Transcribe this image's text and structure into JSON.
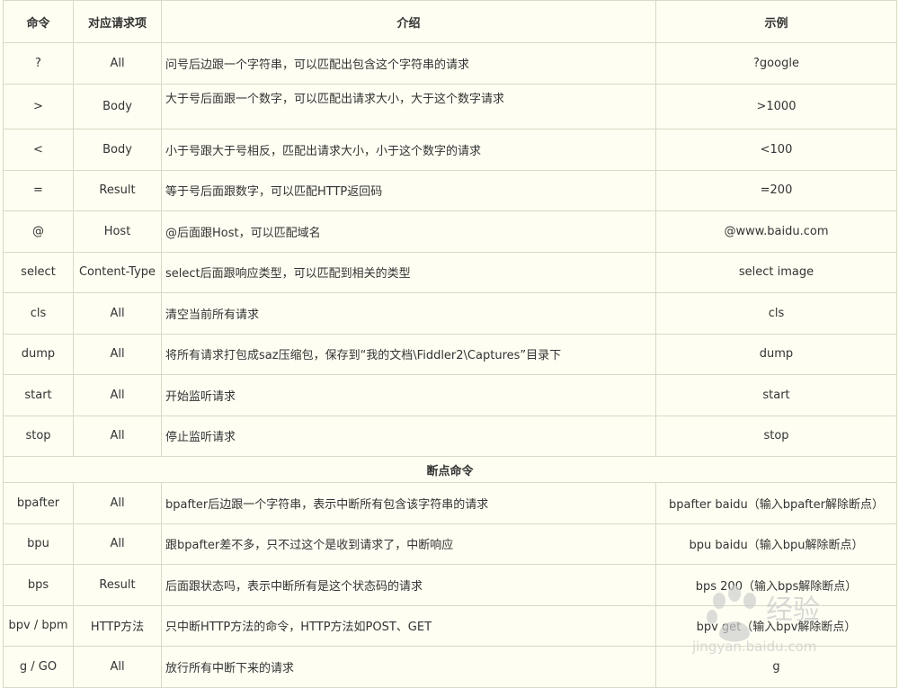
{
  "headers": {
    "command": "命令",
    "target": "对应请求项",
    "intro": "介绍",
    "example": "示例"
  },
  "rows": [
    {
      "command": "?",
      "target": "All",
      "intro": "问号后边跟一个字符串，可以匹配出包含这个字符串的请求",
      "example": "?google"
    },
    {
      "command": ">",
      "target": "Body",
      "intro": "大于号后面跟一个数字，可以匹配出请求大小，大于这个数字请求",
      "example": ">1000",
      "intro_top": true
    },
    {
      "command": "<",
      "target": "Body",
      "intro": "小于号跟大于号相反，匹配出请求大小，小于这个数字的请求",
      "example": "<100"
    },
    {
      "command": "=",
      "target": "Result",
      "intro": "等于号后面跟数字，可以匹配HTTP返回码",
      "example": "=200"
    },
    {
      "command": "@",
      "target": "Host",
      "intro": "@后面跟Host，可以匹配域名",
      "example": "@www.baidu.com"
    },
    {
      "command": "select",
      "target": "Content-Type",
      "intro": "select后面跟响应类型，可以匹配到相关的类型",
      "example": "select image"
    },
    {
      "command": "cls",
      "target": "All",
      "intro": "清空当前所有请求",
      "example": "cls"
    },
    {
      "command": "dump",
      "target": "All",
      "intro": "将所有请求打包成saz压缩包，保存到“我的文档\\Fiddler2\\Captures”目录下",
      "example": "dump"
    },
    {
      "command": "start",
      "target": "All",
      "intro": "开始监听请求",
      "example": "start"
    },
    {
      "command": "stop",
      "target": "All",
      "intro": "停止监听请求",
      "example": "stop"
    }
  ],
  "section_title": "断点命令",
  "bp_rows": [
    {
      "command": "bpafter",
      "target": "All",
      "intro": "bpafter后边跟一个字符串，表示中断所有包含该字符串的请求",
      "example": "bpafter baidu（输入bpafter解除断点）"
    },
    {
      "command": "bpu",
      "target": "All",
      "intro": "跟bpafter差不多，只不过这个是收到请求了，中断响应",
      "example": "bpu baidu（输入bpu解除断点）"
    },
    {
      "command": "bps",
      "target": "Result",
      "intro": "后面跟状态吗，表示中断所有是这个状态码的请求",
      "example": "bps 200（输入bps解除断点）"
    },
    {
      "command": "bpv / bpm",
      "target": "HTTP方法",
      "intro": "只中断HTTP方法的命令，HTTP方法如POST、GET",
      "example": "bpv get（输入bpv解除断点）"
    },
    {
      "command": "g  / GO",
      "target": "All",
      "intro": "放行所有中断下来的请求",
      "example": "g"
    }
  ],
  "watermark": {
    "brand": "Baidu",
    "text": "经验",
    "url": "jingyan.baidu.com",
    "icon": "baidu-paw-icon"
  }
}
